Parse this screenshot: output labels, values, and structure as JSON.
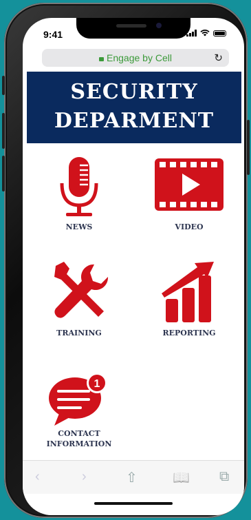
{
  "status": {
    "time": "9:41"
  },
  "browser": {
    "url": "Engage by Cell"
  },
  "banner": {
    "line1": "SECURITY",
    "line2": "DEPARMENT"
  },
  "tiles": [
    {
      "label": "NEWS",
      "icon": "microphone-icon"
    },
    {
      "label": "VIDEO",
      "icon": "video-play-icon"
    },
    {
      "label": "TRAINING",
      "icon": "tools-icon"
    },
    {
      "label": "REPORTING",
      "icon": "growth-chart-icon"
    },
    {
      "label_line1": "CONTACT",
      "label_line2": "INFORMATION",
      "icon": "chat-bubble-icon",
      "badge": "1"
    }
  ],
  "toolbar": {
    "back": "‹",
    "forward": "›",
    "share": "⇧",
    "bookmarks": "📖",
    "tabs": "⧉"
  },
  "colors": {
    "accent_red": "#d0121b",
    "banner_navy": "#0a2a5e",
    "url_green": "#3c9a3a",
    "background": "#14919b"
  }
}
